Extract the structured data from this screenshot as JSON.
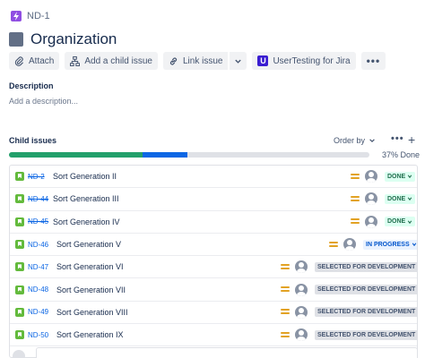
{
  "breadcrumb": {
    "issue_key": "ND-1"
  },
  "issue": {
    "title": "Organization"
  },
  "toolbar": {
    "attach_label": "Attach",
    "add_child_label": "Add a child issue",
    "link_label": "Link issue",
    "plugin_label": "UserTesting for Jira",
    "plugin_icon_letter": "U",
    "more_label": "•••"
  },
  "description": {
    "heading": "Description",
    "placeholder": "Add a description..."
  },
  "child_issues": {
    "heading": "Child issues",
    "order_by_label": "Order by",
    "more_label": "•••",
    "add_label": "+",
    "progress_done_fraction": 0.37,
    "progress_in_progress_fraction": 0.125,
    "progress_label": "37% Done",
    "items": [
      {
        "key": "ND-2",
        "summary": "Sort Generation II",
        "status": "DONE",
        "status_kind": "done",
        "key_done": true
      },
      {
        "key": "ND-44",
        "summary": "Sort Generation III",
        "status": "DONE",
        "status_kind": "done",
        "key_done": true
      },
      {
        "key": "ND-45",
        "summary": "Sort Generation IV",
        "status": "DONE",
        "status_kind": "done",
        "key_done": true
      },
      {
        "key": "ND-46",
        "summary": "Sort Generation V",
        "status": "IN PROGRESS",
        "status_kind": "inprogress",
        "key_done": false
      },
      {
        "key": "ND-47",
        "summary": "Sort Generation VI",
        "status": "SELECTED FOR DEVELOPMENT",
        "status_kind": "selected",
        "key_done": false
      },
      {
        "key": "ND-48",
        "summary": "Sort Generation VII",
        "status": "SELECTED FOR DEVELOPMENT",
        "status_kind": "selected",
        "key_done": false
      },
      {
        "key": "ND-49",
        "summary": "Sort Generation VIII",
        "status": "SELECTED FOR DEVELOPMENT",
        "status_kind": "selected",
        "key_done": false
      },
      {
        "key": "ND-50",
        "summary": "Sort Generation IX",
        "status": "SELECTED FOR DEVELOPMENT",
        "status_kind": "selected",
        "key_done": false
      }
    ]
  },
  "colors": {
    "epic": "#904ee2",
    "story": "#63ba3c",
    "priority_medium": "#e2a224",
    "progress_done": "#22a06b",
    "progress_in_progress": "#0c66e4",
    "link": "#0c66e4"
  },
  "icons": {
    "epic": "lightning-icon",
    "attach": "paperclip-icon",
    "add_child": "hierarchy-icon",
    "link": "link-icon",
    "story": "bookmark-icon",
    "priority": "priority-medium-icon",
    "assignee": "avatar-placeholder-icon"
  }
}
